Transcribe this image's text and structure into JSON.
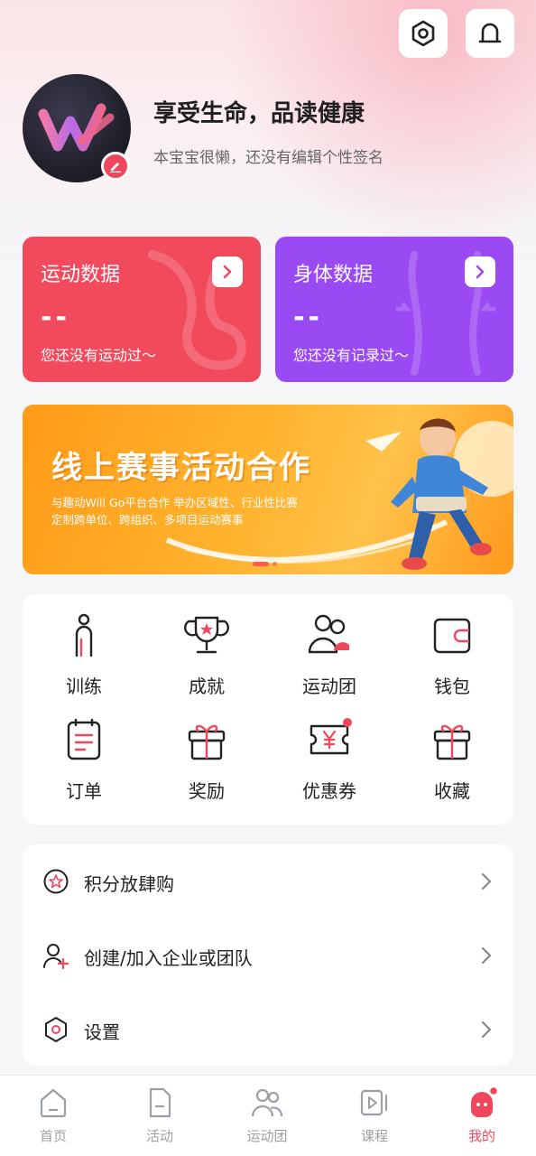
{
  "header": {
    "settings_icon": "hexagon-gear-icon",
    "notify_icon": "bell-icon"
  },
  "profile": {
    "name": "享受生命，品读健康",
    "signature": "本宝宝很懒，还没有编辑个性签名",
    "avatar_icon": "w-logo-avatar",
    "edit_icon": "pencil-icon"
  },
  "stats": {
    "sport": {
      "title": "运动数据",
      "value": "--",
      "desc": "您还没有运动过～",
      "color": "#f24a5d"
    },
    "body": {
      "title": "身体数据",
      "value": "--",
      "desc": "您还没有记录过～",
      "color": "#9a4af2"
    }
  },
  "banner": {
    "title": "线上赛事活动合作",
    "sub1": "与趣动Will Go平台合作 举办区域性、行业性比赛",
    "sub2": "定制跨单位、跨组织、多项目运动赛事",
    "slide_count": 2,
    "active_slide": 1
  },
  "grid": [
    {
      "label": "训练",
      "icon": "person-icon"
    },
    {
      "label": "成就",
      "icon": "trophy-icon"
    },
    {
      "label": "运动团",
      "icon": "group-icon"
    },
    {
      "label": "钱包",
      "icon": "wallet-icon"
    },
    {
      "label": "订单",
      "icon": "order-icon"
    },
    {
      "label": "奖励",
      "icon": "gift-icon"
    },
    {
      "label": "优惠券",
      "icon": "coupon-icon",
      "badge": true
    },
    {
      "label": "收藏",
      "icon": "favorite-gift-icon"
    }
  ],
  "list": [
    {
      "label": "积分放肆购",
      "icon": "points-star-icon"
    },
    {
      "label": "创建/加入企业或团队",
      "icon": "add-user-icon"
    },
    {
      "label": "设置",
      "icon": "settings-hexagon-icon"
    }
  ],
  "tabs": [
    {
      "label": "首页",
      "icon": "home-icon"
    },
    {
      "label": "活动",
      "icon": "activity-icon"
    },
    {
      "label": "运动团",
      "icon": "group-tab-icon"
    },
    {
      "label": "课程",
      "icon": "course-icon"
    },
    {
      "label": "我的",
      "icon": "mine-icon",
      "active": true
    }
  ],
  "colors": {
    "accent": "#f0475d",
    "inactive": "#9aa0a6"
  }
}
